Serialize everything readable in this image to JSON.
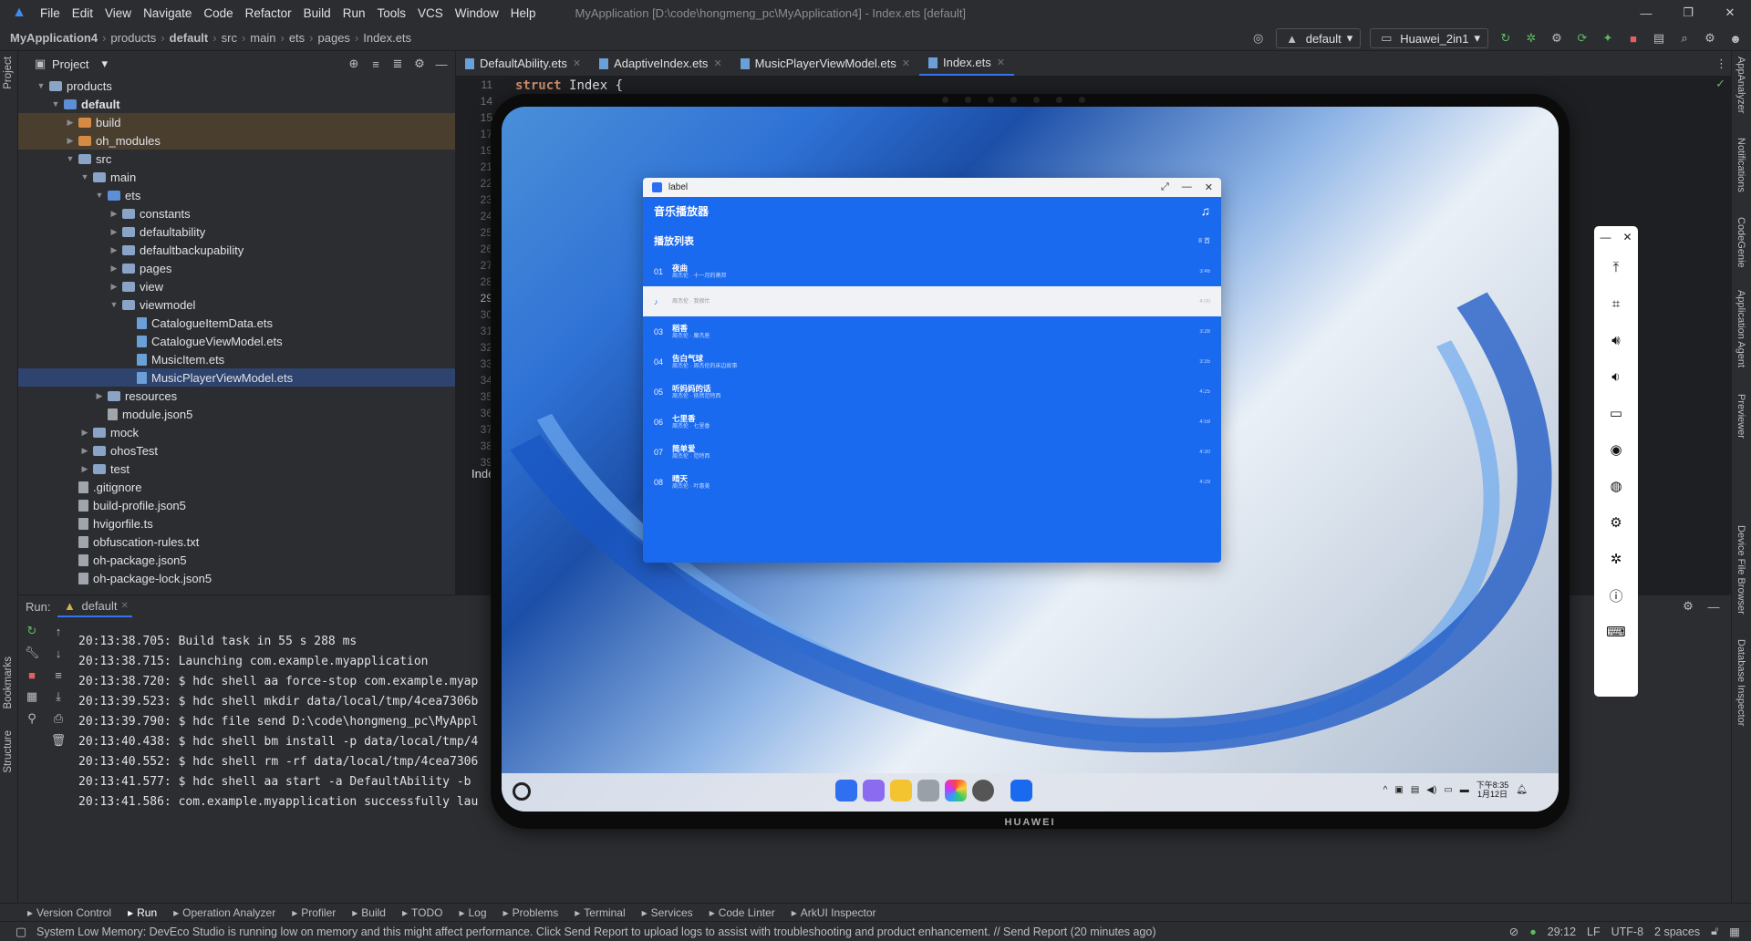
{
  "titlebar": {
    "menu": [
      "File",
      "Edit",
      "View",
      "Navigate",
      "Code",
      "Refactor",
      "Build",
      "Run",
      "Tools",
      "VCS",
      "Window",
      "Help"
    ],
    "title": "MyApplication [D:\\code\\hongmeng_pc\\MyApplication4] - Index.ets [default]"
  },
  "breadcrumb": [
    "MyApplication4",
    "products",
    "default",
    "src",
    "main",
    "ets",
    "pages",
    "Index.ets"
  ],
  "toolbar": {
    "config": "default",
    "device": "Huawei_2in1"
  },
  "project": {
    "label": "Project",
    "tree": [
      {
        "label": "products",
        "depth": 1,
        "type": "folder",
        "open": true
      },
      {
        "label": "default",
        "depth": 2,
        "type": "folder-b",
        "open": true,
        "bold": true
      },
      {
        "label": "build",
        "depth": 3,
        "type": "folder-o",
        "hl": true
      },
      {
        "label": "oh_modules",
        "depth": 3,
        "type": "folder-o",
        "hl": true
      },
      {
        "label": "src",
        "depth": 3,
        "type": "folder",
        "open": true
      },
      {
        "label": "main",
        "depth": 4,
        "type": "folder",
        "open": true
      },
      {
        "label": "ets",
        "depth": 5,
        "type": "folder-b",
        "open": true
      },
      {
        "label": "constants",
        "depth": 6,
        "type": "folder"
      },
      {
        "label": "defaultability",
        "depth": 6,
        "type": "folder"
      },
      {
        "label": "defaultbackupability",
        "depth": 6,
        "type": "folder"
      },
      {
        "label": "pages",
        "depth": 6,
        "type": "folder"
      },
      {
        "label": "view",
        "depth": 6,
        "type": "folder"
      },
      {
        "label": "viewmodel",
        "depth": 6,
        "type": "folder",
        "open": true
      },
      {
        "label": "CatalogueItemData.ets",
        "depth": 7,
        "type": "ets"
      },
      {
        "label": "CatalogueViewModel.ets",
        "depth": 7,
        "type": "ets"
      },
      {
        "label": "MusicItem.ets",
        "depth": 7,
        "type": "ets"
      },
      {
        "label": "MusicPlayerViewModel.ets",
        "depth": 7,
        "type": "ets",
        "sel": true
      },
      {
        "label": "resources",
        "depth": 5,
        "type": "folder"
      },
      {
        "label": "module.json5",
        "depth": 5,
        "type": "file",
        "leaf": true
      },
      {
        "label": "mock",
        "depth": 4,
        "type": "folder"
      },
      {
        "label": "ohosTest",
        "depth": 4,
        "type": "folder"
      },
      {
        "label": "test",
        "depth": 4,
        "type": "folder"
      },
      {
        "label": ".gitignore",
        "depth": 3,
        "type": "file",
        "leaf": true
      },
      {
        "label": "build-profile.json5",
        "depth": 3,
        "type": "file",
        "leaf": true
      },
      {
        "label": "hvigorfile.ts",
        "depth": 3,
        "type": "file",
        "leaf": true
      },
      {
        "label": "obfuscation-rules.txt",
        "depth": 3,
        "type": "file",
        "leaf": true
      },
      {
        "label": "oh-package.json5",
        "depth": 3,
        "type": "file",
        "leaf": true
      },
      {
        "label": "oh-package-lock.json5",
        "depth": 3,
        "type": "file",
        "leaf": true
      }
    ]
  },
  "editor": {
    "tabs": [
      "DefaultAbility.ets",
      "AdaptiveIndex.ets",
      "MusicPlayerViewModel.ets",
      "Index.ets"
    ],
    "active_tab": 3,
    "line_numbers": [
      "11",
      "14",
      "15",
      "17",
      "19",
      "21",
      "22",
      "23",
      "24",
      "25",
      "26",
      "27",
      "28",
      "29",
      "30",
      "31",
      "32",
      "33",
      "34",
      "35",
      "36",
      "37",
      "38",
      "39"
    ],
    "code_keyword": "struct",
    "code_name": "Index {",
    "partial_text": "Inde"
  },
  "run": {
    "label": "Run:",
    "tab": "default",
    "log": [
      "20:13:38.705: Build task in 55 s 288 ms",
      "20:13:38.715: Launching com.example.myapplication",
      "20:13:38.720: $ hdc shell aa force-stop com.example.myap",
      "20:13:39.523: $ hdc shell mkdir data/local/tmp/4cea7306b",
      "20:13:39.790: $ hdc file send D:\\code\\hongmeng_pc\\MyAppl",
      "20:13:40.438: $ hdc shell bm install -p data/local/tmp/4",
      "20:13:40.552: $ hdc shell rm -rf data/local/tmp/4cea7306",
      "20:13:41.577: $ hdc shell aa start -a DefaultAbility -b",
      "20:13:41.586: com.example.myapplication successfully lau"
    ]
  },
  "left_strip": {
    "project": "Project",
    "bookmarks": "Bookmarks",
    "structure": "Structure"
  },
  "right_strip": [
    "AppAnalyzer",
    "Notifications",
    "CodeGenie",
    "Application Agent",
    "Previewer",
    "Device File Browser",
    "Database Inspector"
  ],
  "bottom_tools": [
    "Version Control",
    "Run",
    "Operation Analyzer",
    "Profiler",
    "Build",
    "TODO",
    "Log",
    "Problems",
    "Terminal",
    "Services",
    "Code Linter",
    "ArkUI Inspector"
  ],
  "status": {
    "message": "System Low Memory: DevEco Studio is running low on memory and this might affect performance. Click Send Report to upload logs to assist with troubleshooting and product enhancement. // Send Report (20 minutes ago)",
    "position": "29:12",
    "line_sep": "LF",
    "encoding": "UTF-8",
    "indent": "2 spaces"
  },
  "device": {
    "brand": "HUAWEI",
    "clock_time": "下午8:35",
    "clock_date": "1月12日"
  },
  "app": {
    "window_title": "label",
    "header": "音乐播放器",
    "playlist_title": "播放列表",
    "count": "8 首",
    "songs": [
      {
        "num": "01",
        "title": "夜曲",
        "artist": "周杰伦 · 十一月的萧邦",
        "dur": "3:46"
      },
      {
        "num": "♪",
        "title": "",
        "artist": "周杰伦 · 我很忙",
        "dur": "4:00",
        "playing": true
      },
      {
        "num": "03",
        "title": "稻香",
        "artist": "周杰伦 · 魔杰座",
        "dur": "3:28"
      },
      {
        "num": "04",
        "title": "告白气球",
        "artist": "周杰伦 · 周杰伦的床边故事",
        "dur": "3:35"
      },
      {
        "num": "05",
        "title": "听妈妈的话",
        "artist": "周杰伦 · 依然范特西",
        "dur": "4:25"
      },
      {
        "num": "06",
        "title": "七里香",
        "artist": "周杰伦 · 七里香",
        "dur": "4:59"
      },
      {
        "num": "07",
        "title": "简单爱",
        "artist": "周杰伦 · 范特西",
        "dur": "4:30"
      },
      {
        "num": "08",
        "title": "晴天",
        "artist": "周杰伦 · 叶惠美",
        "dur": "4:29"
      }
    ]
  },
  "colors": {
    "accent": "#3574f0",
    "app_blue": "#1a6af0",
    "ide_bg": "#2b2d30",
    "editor_bg": "#1e1f22"
  }
}
